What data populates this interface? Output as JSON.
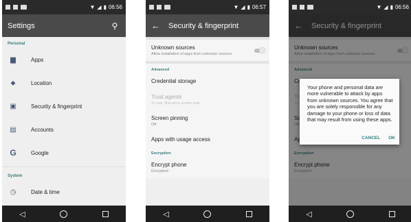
{
  "status": {
    "time1": "06:56",
    "time2": "06:57",
    "time3": "06:56"
  },
  "screen1": {
    "title": "Settings",
    "personal_label": "Personal",
    "items": [
      {
        "label": "Apps",
        "icon": "apps-icon"
      },
      {
        "label": "Location",
        "icon": "location-icon"
      },
      {
        "label": "Security & fingerprint",
        "icon": "lock-icon"
      },
      {
        "label": "Accounts",
        "icon": "accounts-icon"
      },
      {
        "label": "Google",
        "icon": "google-icon"
      }
    ],
    "system_label": "System",
    "system_items": [
      {
        "label": "Date & time",
        "icon": "clock-icon"
      }
    ]
  },
  "screen2": {
    "title": "Security & fingerprint",
    "unknown_sources": {
      "title": "Unknown sources",
      "desc": "Allow installation of apps from unknown sources"
    },
    "advanced_label": "Advanced",
    "credential": "Credential storage",
    "trust_agents": {
      "title": "Trust agents",
      "desc": "To use, first set a screen lock"
    },
    "screen_pinning": {
      "title": "Screen pinning",
      "desc": "Off"
    },
    "usage_access": "Apps with usage access",
    "encryption_label": "Encryption",
    "encrypt_phone": {
      "title": "Encrypt phone",
      "desc": "Encrypted"
    }
  },
  "screen3": {
    "title": "Security & fingerprint",
    "dialog": {
      "message": "Your phone and personal data are more vulnerable to attack by apps from unknown sources. You agree that you are solely responsible for any damage to your phone or loss of data that may result from using these apps.",
      "cancel": "CANCEL",
      "ok": "OK"
    }
  },
  "colors": {
    "appbar": "#4a4a4a",
    "accent": "#3a7c7c",
    "statusbar": "#2a2a2a",
    "navbar": "#1f1f1f"
  }
}
